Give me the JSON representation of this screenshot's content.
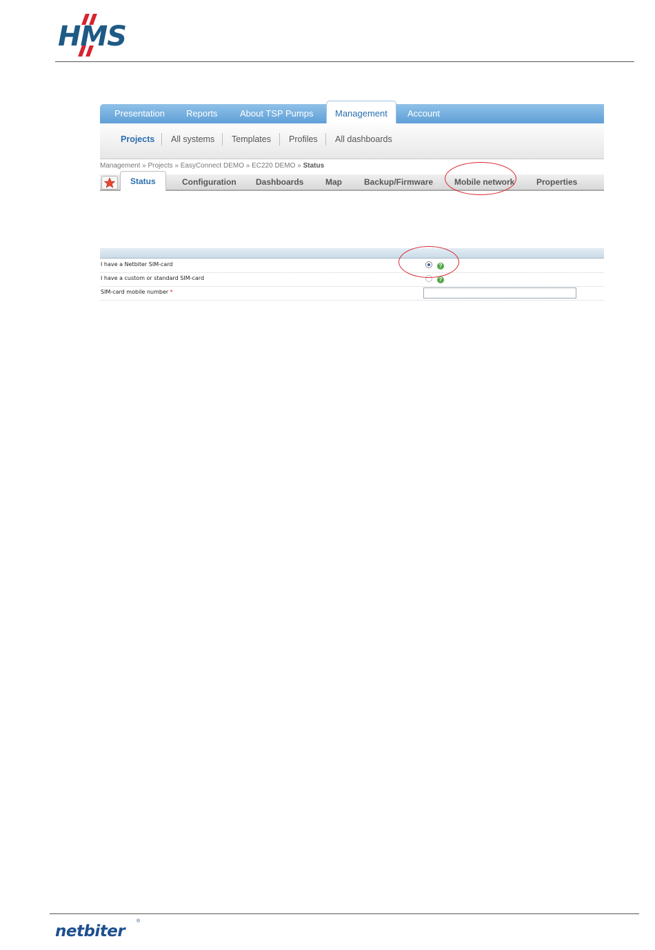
{
  "header": {
    "logo_text": "HMS"
  },
  "app": {
    "main_nav": [
      {
        "label": "Presentation",
        "active": false
      },
      {
        "label": "Reports",
        "active": false
      },
      {
        "label": "About TSP Pumps",
        "active": false
      },
      {
        "label": "Management",
        "active": true
      },
      {
        "label": "Account",
        "active": false
      }
    ],
    "sub_nav": [
      {
        "label": "Projects",
        "active": true
      },
      {
        "label": "All systems",
        "active": false
      },
      {
        "label": "Templates",
        "active": false
      },
      {
        "label": "Profiles",
        "active": false
      },
      {
        "label": "All dashboards",
        "active": false
      }
    ],
    "breadcrumb": {
      "path": "Management » Projects » EasyConnect DEMO » EC220 DEMO » ",
      "current": "Status"
    },
    "tabs": [
      {
        "label": "Status",
        "active": true
      },
      {
        "label": "Configuration",
        "active": false
      },
      {
        "label": "Dashboards",
        "active": false
      },
      {
        "label": "Map",
        "active": false
      },
      {
        "label": "Backup/Firmware",
        "active": false
      },
      {
        "label": "Mobile network",
        "active": false,
        "highlighted": true
      },
      {
        "label": "Properties",
        "active": false
      }
    ],
    "sim_form": {
      "option_netbiter": {
        "label": "I have a Netbiter SIM-card",
        "selected": true
      },
      "option_custom": {
        "label": "I have a custom or standard SIM-card",
        "selected": false
      },
      "mobile_number": {
        "label": "SIM-card mobile number",
        "required_mark": "*",
        "value": ""
      },
      "help_glyph": "?"
    }
  },
  "footer": {
    "logo_text": "netbiter",
    "registered_mark": "®"
  },
  "colors": {
    "nav_blue": "#5f9fd6",
    "callout_red": "#d9232c",
    "brand_blue": "#1e5a85",
    "brand_red": "#d7232f"
  }
}
